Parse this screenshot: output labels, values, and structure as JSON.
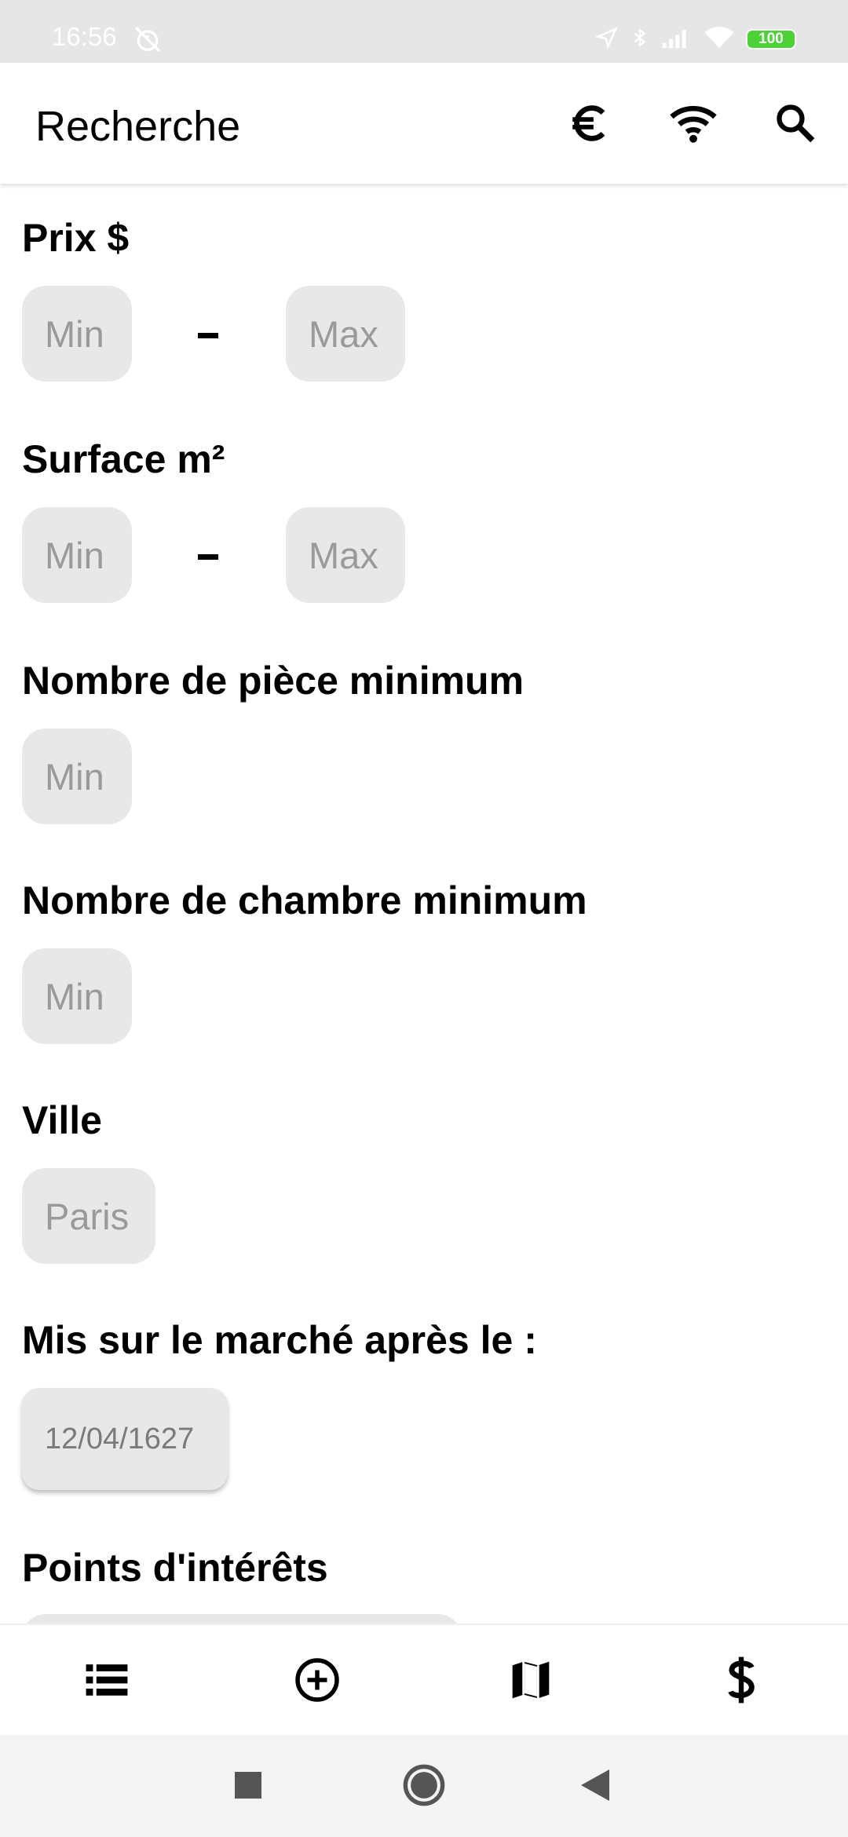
{
  "status_bar": {
    "time": "16:56",
    "battery": "100"
  },
  "appbar": {
    "title": "Recherche",
    "icons": [
      "euro-icon",
      "wifi-icon",
      "search-icon"
    ]
  },
  "form": {
    "price": {
      "label": "Prix $",
      "min_placeholder": "Min",
      "max_placeholder": "Max"
    },
    "surface": {
      "label": "Surface m²",
      "min_placeholder": "Min",
      "max_placeholder": "Max"
    },
    "rooms": {
      "label": "Nombre de pièce minimum",
      "placeholder": "Min"
    },
    "bedrooms": {
      "label": "Nombre de chambre minimum",
      "placeholder": "Min"
    },
    "city": {
      "label": "Ville",
      "placeholder": "Paris"
    },
    "market_date": {
      "label": "Mis sur le marché après le :",
      "value": "12/04/1627"
    },
    "points_of_interest": {
      "label": "Points d'intérêts"
    }
  },
  "bottom_nav": [
    "list-icon",
    "add-circle-icon",
    "map-icon",
    "dollar-icon"
  ],
  "system_nav": [
    "recents-icon",
    "home-icon",
    "back-icon"
  ]
}
